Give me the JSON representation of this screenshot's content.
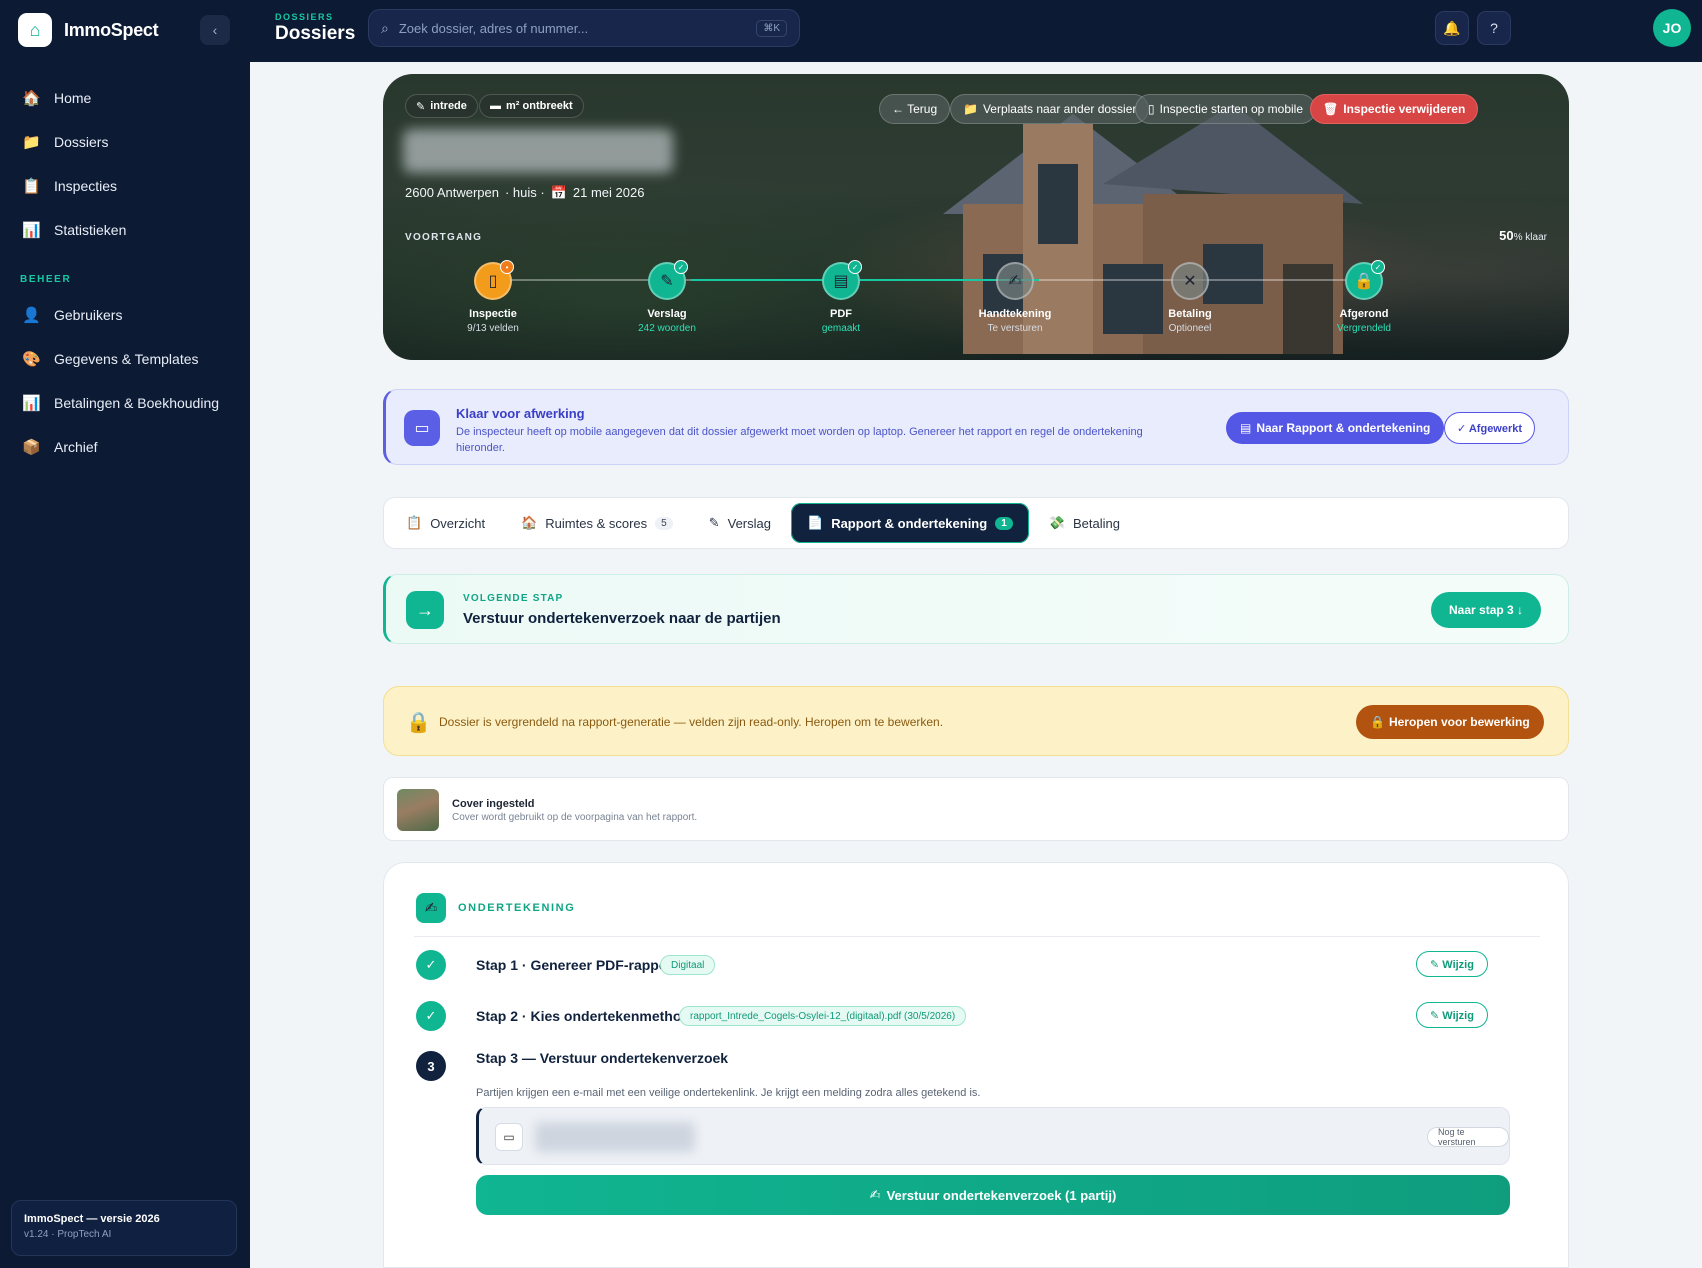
{
  "brand": {
    "name": "ImmoSpect",
    "collapse_icon": "chevron-left-icon"
  },
  "sidebar": {
    "items": [
      {
        "label": "Home",
        "icon": "🏠"
      },
      {
        "label": "Dossiers",
        "icon": "📁"
      },
      {
        "label": "Inspecties",
        "icon": "📋"
      },
      {
        "label": "Statistieken",
        "icon": "📊"
      }
    ],
    "section_beheer": "BEHEER",
    "beheer_items": [
      {
        "label": "Gebruikers",
        "icon": "👤"
      },
      {
        "label": "Gegevens & Templates",
        "icon": "🎨"
      },
      {
        "label": "Betalingen & Boekhouding",
        "icon": "📊"
      },
      {
        "label": "Archief",
        "icon": "📦"
      }
    ],
    "version_title": "ImmoSpect — versie 2026",
    "version_sub": "v1.24 · PropTech AI"
  },
  "topbar": {
    "crumb_small": "DOSSIERS",
    "crumb_big": "Dossiers",
    "search_placeholder": "Zoek dossier, adres of nummer...",
    "search_kbd": "⌘K",
    "avatar_initials": "JO"
  },
  "hero": {
    "chip_intrede": "intrede",
    "chip_m2": "m² ontbreekt",
    "btn_terug": "← Terug",
    "btn_verplaats": "Verplaats naar ander dossier",
    "btn_mobile": "Inspectie starten op mobile",
    "btn_delete": "Inspectie verwijderen",
    "meta_city": "2600 Antwerpen",
    "meta_type": "· huis ·",
    "meta_date": "21 mei 2026",
    "voortgang_label": "VOORTGANG",
    "percent_value": "50",
    "percent_suffix": "% klaar",
    "progress_fraction": 0.4,
    "steps": [
      {
        "label": "Inspectie",
        "sub": "9/13 velden"
      },
      {
        "label": "Verslag",
        "sub": "242 woorden"
      },
      {
        "label": "PDF",
        "sub": "gemaakt"
      },
      {
        "label": "Handtekening",
        "sub": "Te versturen"
      },
      {
        "label": "Betaling",
        "sub": "Optioneel"
      },
      {
        "label": "Afgerond",
        "sub": "Vergrendeld"
      }
    ]
  },
  "klaar": {
    "title": "Klaar voor afwerking",
    "text": "De inspecteur heeft op mobile aangegeven dat dit dossier afgewerkt moet worden op laptop. Genereer het rapport en regel de ondertekening hieronder.",
    "btn_primary": "Naar Rapport & ondertekening",
    "btn_secondary": "✓ Afgewerkt"
  },
  "tabs": [
    {
      "label": "Overzicht",
      "icon": "📋",
      "count": ""
    },
    {
      "label": "Ruimtes & scores",
      "icon": "🏠",
      "count": "5"
    },
    {
      "label": "Verslag",
      "icon": "✎",
      "count": ""
    },
    {
      "label": "Rapport & ondertekening",
      "icon": "📄",
      "count": "1"
    },
    {
      "label": "Betaling",
      "icon": "💸",
      "count": ""
    }
  ],
  "volgende": {
    "small": "VOLGENDE STAP",
    "title": "Verstuur ondertekenverzoek naar de partijen",
    "btn": "Naar stap 3 ↓"
  },
  "locked": {
    "text": "Dossier is vergrendeld na rapport-generatie — velden zijn read-only. Heropen om te bewerken.",
    "btn": "Heropen voor bewerking"
  },
  "cover": {
    "title": "Cover ingesteld",
    "sub": "Cover wordt gebruikt op de voorpagina van het rapport."
  },
  "onder": {
    "heading": "ONDERTEKENING",
    "step1_title": "Stap 1 · Genereer PDF-rapport",
    "step1_tag": "Digitaal",
    "step2_title": "Stap 2 · Kies ondertekenmethode",
    "step2_tag": "rapport_Intrede_Cogels-Osylei-12_(digitaal).pdf (30/5/2026)",
    "wijzig": "✎ Wijzig",
    "step3_num": "3",
    "step3_title": "Stap 3 — Verstuur ondertekenverzoek",
    "step3_desc": "Partijen krijgen een e-mail met een veilige ondertekenlink. Je krijgt een melding zodra alles getekend is.",
    "party_status": "Nog te versturen",
    "send_btn": "Verstuur ondertekenverzoek (1 partij)"
  },
  "colors": {
    "navy": "#0d1a33",
    "green": "#10b591",
    "indigo": "#5457e6",
    "danger": "#d84545"
  }
}
